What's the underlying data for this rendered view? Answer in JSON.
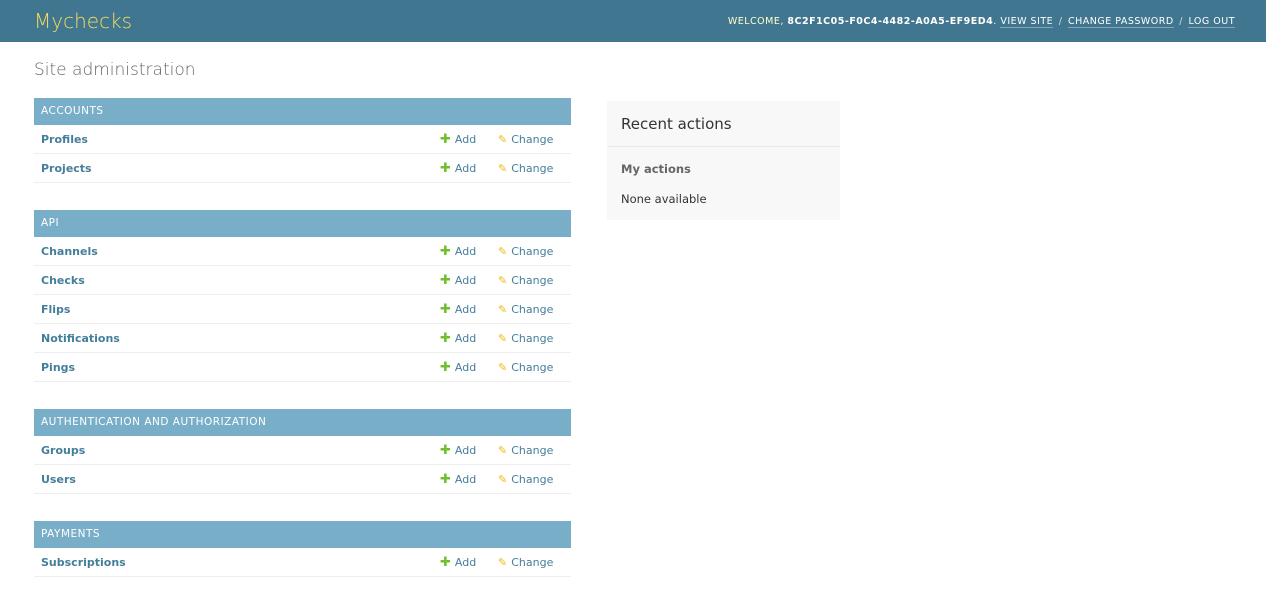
{
  "header": {
    "brand": "Mychecks",
    "welcome": "Welcome,",
    "user": "8C2F1C05-F0C4-4482-A0A5-EF9ED4",
    "view_site": "View site",
    "change_password": "Change password",
    "log_out": "Log out"
  },
  "page": {
    "title": "Site administration"
  },
  "modules": [
    {
      "caption": "Accounts",
      "models": [
        "Profiles",
        "Projects"
      ]
    },
    {
      "caption": "API",
      "models": [
        "Channels",
        "Checks",
        "Flips",
        "Notifications",
        "Pings"
      ]
    },
    {
      "caption": "Authentication and Authorization",
      "models": [
        "Groups",
        "Users"
      ]
    },
    {
      "caption": "Payments",
      "models": [
        "Subscriptions"
      ]
    }
  ],
  "actions": {
    "add": "Add",
    "change": "Change"
  },
  "recent": {
    "title": "Recent actions",
    "my_actions": "My actions",
    "none": "None available"
  },
  "colors": {
    "header": "#417690",
    "brand": "#f5dd5d",
    "caption": "#79aec8",
    "link": "#447e9b",
    "add_icon": "#70bf2b",
    "change_icon": "#efb80b"
  },
  "icons": {
    "add": "plus-icon",
    "change": "pencil-icon"
  }
}
